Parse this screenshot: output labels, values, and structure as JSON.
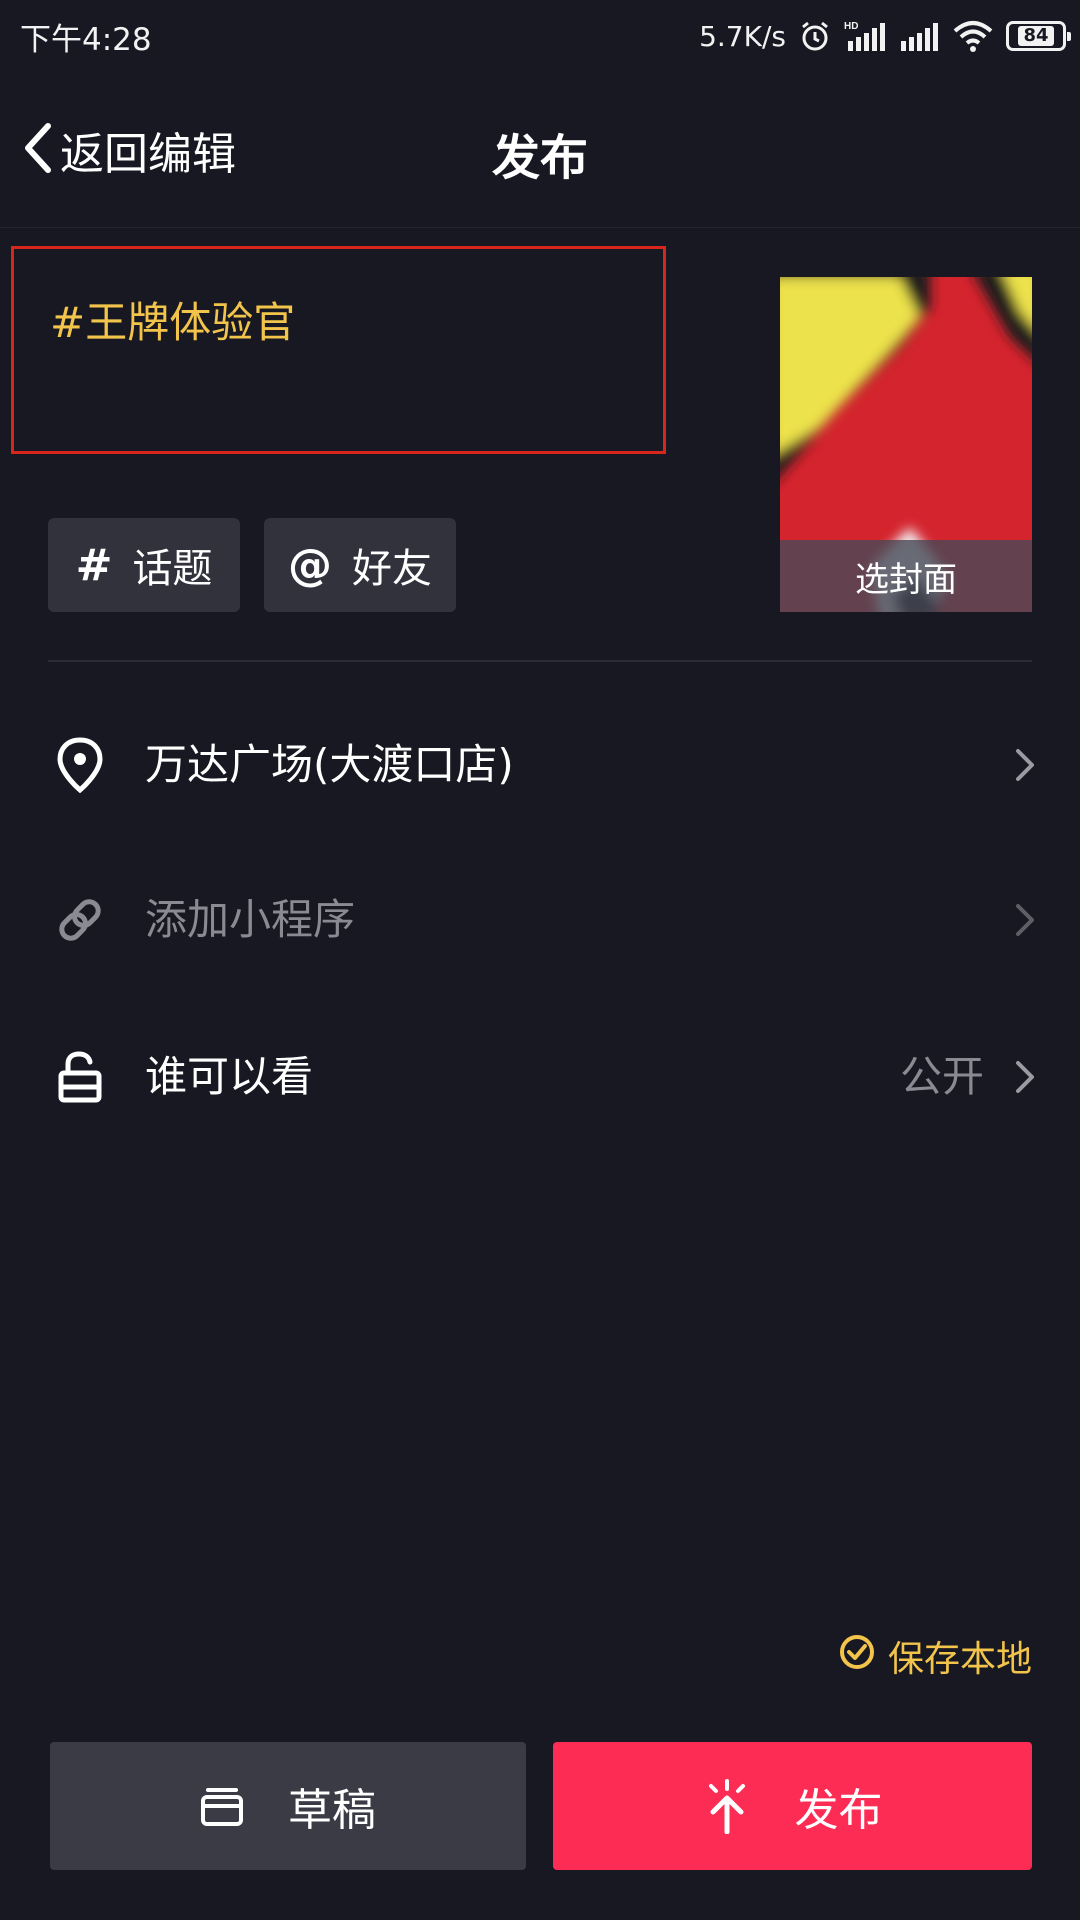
{
  "status_bar": {
    "time": "下午4:28",
    "net_speed": "5.7K/s",
    "battery": "84"
  },
  "nav": {
    "back_label": "返回编辑",
    "title": "发布"
  },
  "caption": {
    "text": "#王牌体验官",
    "color": "#f2c44b"
  },
  "cover": {
    "label": "选封面"
  },
  "chips": {
    "topic": {
      "symbol": "#",
      "label": "话题"
    },
    "friend": {
      "symbol": "@",
      "label": "好友"
    }
  },
  "rows": {
    "location": {
      "icon": "location-pin-icon",
      "label": "万达广场(大渡口店)"
    },
    "miniprogram": {
      "icon": "link-icon",
      "label": "添加小程序"
    },
    "visibility": {
      "icon": "unlock-icon",
      "label": "谁可以看",
      "value": "公开"
    }
  },
  "save_local": {
    "label": "保存本地",
    "checked": true
  },
  "buttons": {
    "draft_label": "草稿",
    "publish_label": "发布"
  },
  "colors": {
    "background": "#171821",
    "accent": "#fd2c55",
    "highlight": "#f2c44b",
    "chip": "#31323c"
  }
}
